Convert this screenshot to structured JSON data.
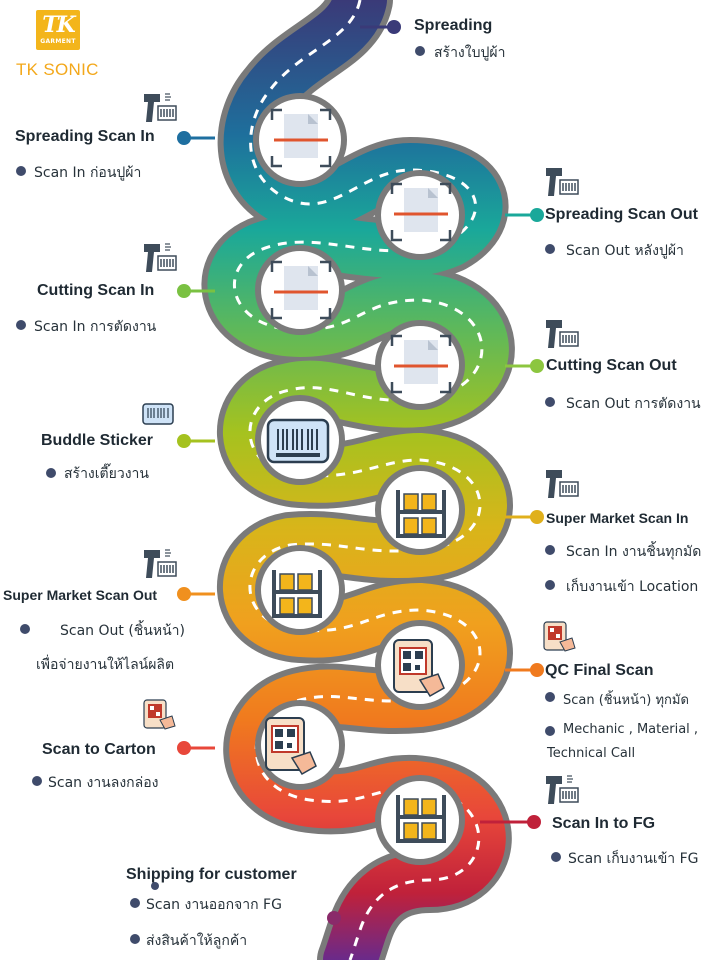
{
  "brand": {
    "logo_mark": "TK",
    "logo_caption": "GARMENT",
    "name": "TK SONIC"
  },
  "steps": [
    {
      "title": "Spreading",
      "lines": [
        "สร้างใบปูผ้า"
      ],
      "color": "#3a3a78"
    },
    {
      "title": "Spreading Scan In",
      "lines": [
        "Scan In ก่อนปูผ้า"
      ],
      "color": "#1e6fa0"
    },
    {
      "title": "Spreading Scan Out",
      "lines": [
        "Scan Out หลังปูผ้า"
      ],
      "color": "#1aa89a"
    },
    {
      "title": "Cutting Scan In",
      "lines": [
        "Scan In การตัดงาน"
      ],
      "color": "#7ac142"
    },
    {
      "title": "Cutting Scan Out",
      "lines": [
        "Scan Out การตัดงาน"
      ],
      "color": "#8cc63f"
    },
    {
      "title": "Buddle Sticker",
      "lines": [
        "สร้างเตี๊ยวงาน"
      ],
      "color": "#a5c21f"
    },
    {
      "title": "Super Market Scan In",
      "lines": [
        "Scan In งานชิ้นทุกมัด",
        "เก็บงานเข้า Location"
      ],
      "color": "#e0b01c"
    },
    {
      "title": "Super Market Scan Out",
      "lines": [
        "Scan Out (ชิ้นหน้า)",
        "เพื่อจ่ายงานให้ไลน์ผลิต"
      ],
      "color": "#f0901e"
    },
    {
      "title": "QC Final Scan",
      "lines": [
        "Scan (ชิ้นหน้า) ทุกมัด",
        "Mechanic , Material ,",
        "Technical Call"
      ],
      "color": "#f07a1e"
    },
    {
      "title": "Scan to Carton",
      "lines": [
        "Scan งานลงกล่อง"
      ],
      "color": "#e8473a"
    },
    {
      "title": "Scan In to FG",
      "lines": [
        "Scan เก็บงานเข้า FG"
      ],
      "color": "#c0213a"
    },
    {
      "title": "Shipping for customer",
      "lines": [
        "Scan งานออกจาก FG",
        "ส่งสินค้าให้ลูกค้า"
      ],
      "color": "#8a2a6a"
    }
  ]
}
